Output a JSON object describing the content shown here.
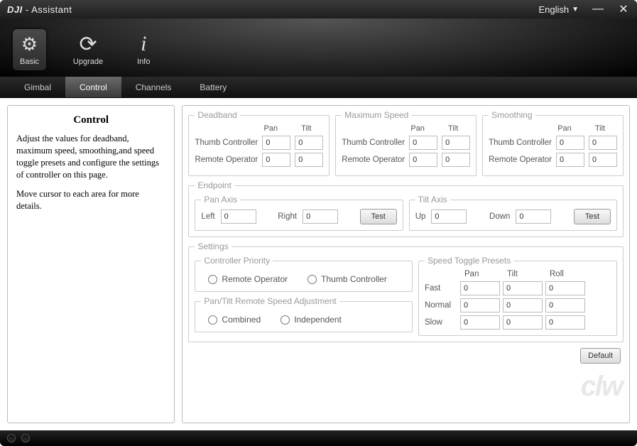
{
  "titlebar": {
    "app_bold": "DJI",
    "app_rest": " - Assistant",
    "language": "English",
    "minimize": "—",
    "close": "✕"
  },
  "toolbar": {
    "basic": "Basic",
    "upgrade": "Upgrade",
    "info_glyph": "i",
    "info": "Info"
  },
  "subtabs": {
    "gimbal": "Gimbal",
    "control": "Control",
    "channels": "Channels",
    "battery": "Battery"
  },
  "side": {
    "heading": "Control",
    "p1": "Adjust the values for deadband, maximum speed, smoothing,and speed toggle presets and configure the settings of controller on this page.",
    "p2": "Move cursor to each area for more details."
  },
  "labels": {
    "deadband": "Deadband",
    "max_speed": "Maximum Speed",
    "smoothing": "Smoothing",
    "pan": "Pan",
    "tilt": "Tilt",
    "thumb_controller": "Thumb Controller",
    "remote_operator": "Remote Operator",
    "endpoint": "Endpoint",
    "pan_axis": "Pan Axis",
    "tilt_axis": "Tilt Axis",
    "left": "Left",
    "right": "Right",
    "up": "Up",
    "down": "Down",
    "test": "Test",
    "settings": "Settings",
    "controller_priority": "Controller Priority",
    "pan_tilt_remote": "Pan/Tilt Remote Speed Adjustment",
    "combined": "Combined",
    "independent": "Independent",
    "speed_toggle_presets": "Speed Toggle Presets",
    "roll": "Roll",
    "fast": "Fast",
    "normal": "Normal",
    "slow": "Slow",
    "default": "Default"
  },
  "values": {
    "deadband": {
      "thumb": {
        "pan": "0",
        "tilt": "0"
      },
      "remote": {
        "pan": "0",
        "tilt": "0"
      }
    },
    "maxspeed": {
      "thumb": {
        "pan": "0",
        "tilt": "0"
      },
      "remote": {
        "pan": "0",
        "tilt": "0"
      }
    },
    "smoothing": {
      "thumb": {
        "pan": "0",
        "tilt": "0"
      },
      "remote": {
        "pan": "0",
        "tilt": "0"
      }
    },
    "endpoint": {
      "pan": {
        "left": "0",
        "right": "0"
      },
      "tilt": {
        "up": "0",
        "down": "0"
      }
    },
    "presets": {
      "fast": {
        "pan": "0",
        "tilt": "0",
        "roll": "0"
      },
      "normal": {
        "pan": "0",
        "tilt": "0",
        "roll": "0"
      },
      "slow": {
        "pan": "0",
        "tilt": "0",
        "roll": "0"
      }
    }
  },
  "watermark": "clw"
}
